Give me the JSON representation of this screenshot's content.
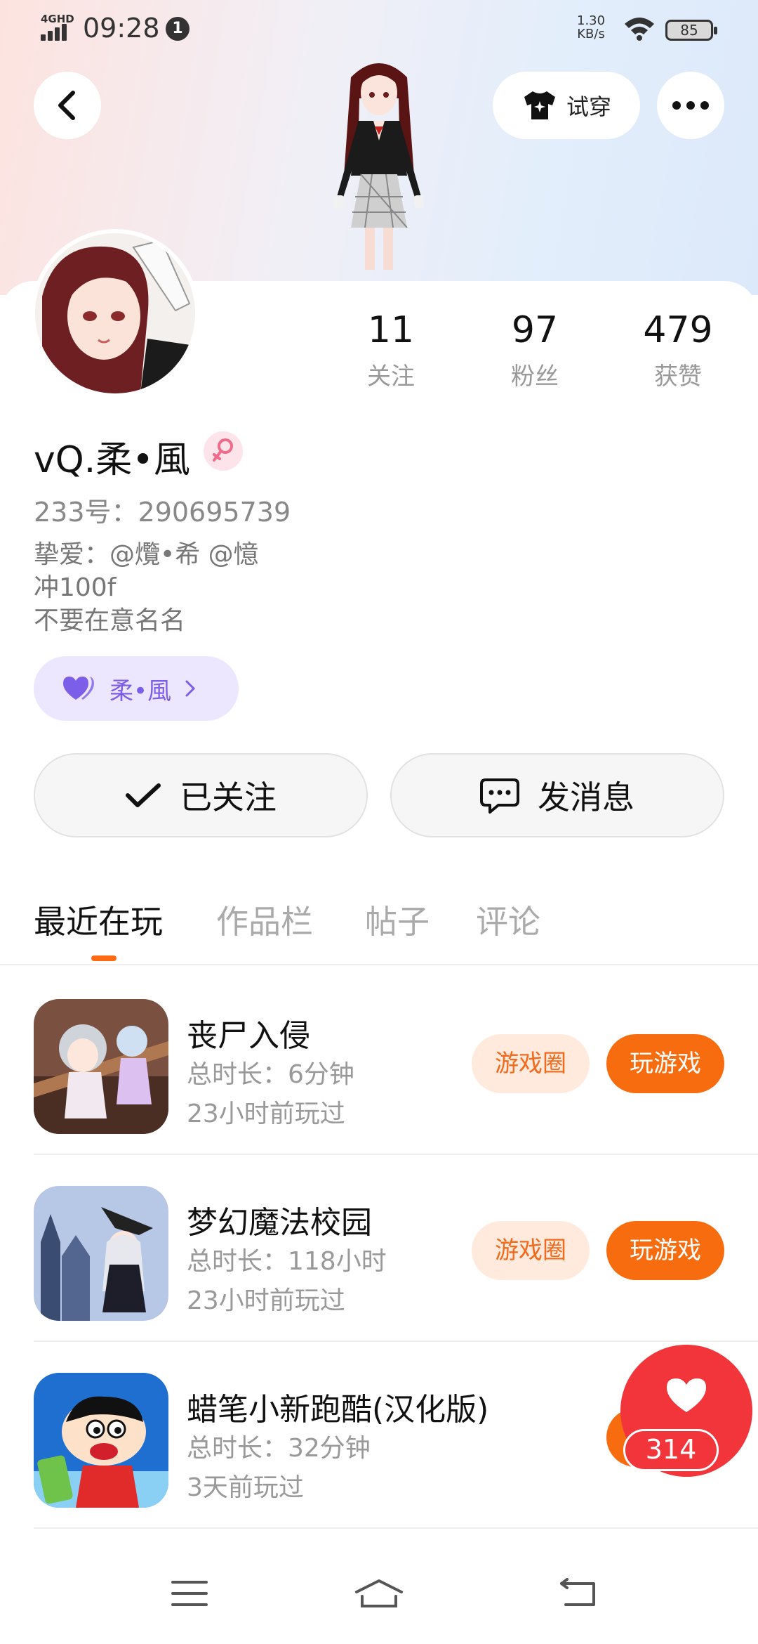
{
  "status_bar": {
    "network": "4GHD",
    "time": "09:28",
    "notification_count": "1",
    "speed_value": "1.30",
    "speed_unit": "KB/s",
    "battery": "85"
  },
  "header": {
    "try_on_label": "试穿"
  },
  "stats": [
    {
      "value": "11",
      "label": "关注"
    },
    {
      "value": "97",
      "label": "粉丝"
    },
    {
      "value": "479",
      "label": "获赞"
    }
  ],
  "profile": {
    "username": "vQ.柔•風",
    "uid": "233号：290695739",
    "bio": "挚爱：@爦•希 @憶\n冲100f\n不要在意名名",
    "tag_label": "柔•風"
  },
  "actions": {
    "followed_label": "已关注",
    "message_label": "发消息"
  },
  "tabs": [
    "最近在玩",
    "作品栏",
    "帖子",
    "评论"
  ],
  "games": [
    {
      "title": "丧尸入侵",
      "duration": "总时长：6分钟",
      "last_played": "23小时前玩过",
      "circle_label": "游戏圈",
      "play_label": "玩游戏"
    },
    {
      "title": "梦幻魔法校园",
      "duration": "总时长：118小时",
      "last_played": "23小时前玩过",
      "circle_label": "游戏圈",
      "play_label": "玩游戏"
    },
    {
      "title": "蜡笔小新跑酷(汉化版)",
      "duration": "总时长：32分钟",
      "last_played": "3天前玩过",
      "circle_label": "",
      "play_label": ""
    }
  ],
  "like_count": "314",
  "colors": {
    "accent_orange": "#f86c10",
    "circle_pill_bg": "#ffeadd",
    "tag_purple": "#7b5fe8",
    "like_red": "#f2343b"
  }
}
